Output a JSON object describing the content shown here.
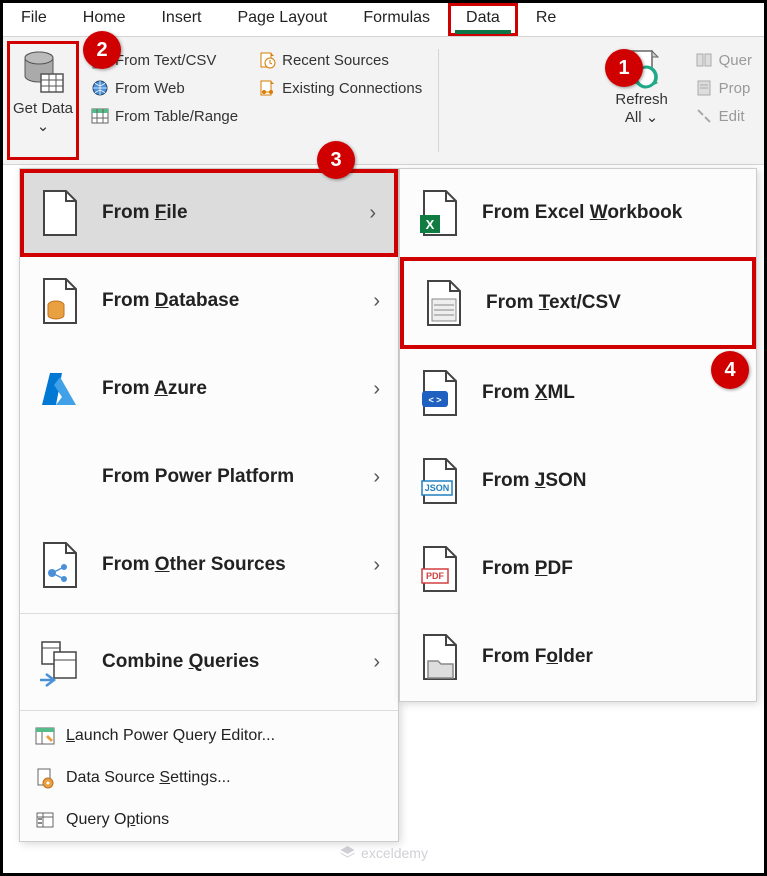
{
  "tabs": {
    "file": "File",
    "home": "Home",
    "insert": "Insert",
    "page_layout": "Page Layout",
    "formulas": "Formulas",
    "data": "Data",
    "review_partial": "Re"
  },
  "ribbon": {
    "get_data": "Get Data",
    "from_text_csv": "From Text/CSV",
    "from_web": "From Web",
    "from_table_range": "From Table/Range",
    "recent_sources": "Recent Sources",
    "existing_connections": "Existing Connections",
    "refresh_all": "Refresh All",
    "queries": "Quer",
    "properties": "Prop",
    "edit": "Edit"
  },
  "menu": {
    "from_file": "From File",
    "from_database": "From Database",
    "from_azure": "From Azure",
    "from_power_platform": "From Power Platform",
    "from_other_sources": "From Other Sources",
    "combine_queries": "Combine Queries",
    "launch_pq": "Launch Power Query Editor...",
    "data_source_settings": "Data Source Settings...",
    "query_options": "Query Options"
  },
  "submenu": {
    "from_workbook": "From Excel Workbook",
    "from_text_csv": "From Text/CSV",
    "from_xml": "From XML",
    "from_json": "From JSON",
    "from_pdf": "From PDF",
    "from_folder": "From Folder"
  },
  "callouts": {
    "c1": "1",
    "c2": "2",
    "c3": "3",
    "c4": "4"
  },
  "watermark": "exceldemy"
}
